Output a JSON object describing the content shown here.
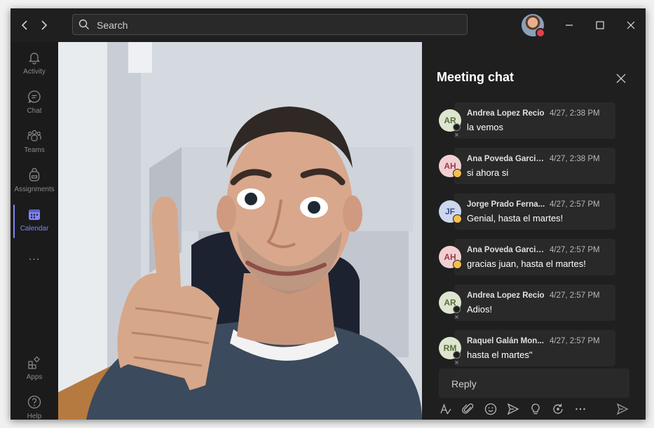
{
  "search": {
    "placeholder": "Search"
  },
  "rail": {
    "items": [
      {
        "id": "activity",
        "label": "Activity"
      },
      {
        "id": "chat",
        "label": "Chat"
      },
      {
        "id": "teams",
        "label": "Teams"
      },
      {
        "id": "assignments",
        "label": "Assignments"
      },
      {
        "id": "calendar",
        "label": "Calendar",
        "active": true
      }
    ],
    "more_label": "...",
    "bottom": [
      {
        "id": "apps",
        "label": "Apps"
      },
      {
        "id": "help",
        "label": "Help"
      }
    ]
  },
  "chat": {
    "title": "Meeting chat",
    "messages": [
      {
        "initials": "AR",
        "name": "Andrea Lopez Recio",
        "time": "4/27, 2:38 PM",
        "text": "la vemos",
        "avatar_bg": "#dde5cf",
        "avatar_fg": "#5a6b3d",
        "status": "offline"
      },
      {
        "initials": "AH",
        "name": "Ana Poveda Garcia...",
        "time": "4/27, 2:38 PM",
        "text": "si ahora si",
        "avatar_bg": "#f2cfd3",
        "avatar_fg": "#9a3b4a",
        "status": "away"
      },
      {
        "initials": "JF",
        "name": "Jorge Prado Ferna...",
        "time": "4/27, 2:57 PM",
        "text": "Genial, hasta el martes!",
        "avatar_bg": "#cdd8ee",
        "avatar_fg": "#3c4f86",
        "status": "away"
      },
      {
        "initials": "AH",
        "name": "Ana Poveda Garcia...",
        "time": "4/27, 2:57 PM",
        "text": "gracias juan, hasta el martes!",
        "avatar_bg": "#f2cfd3",
        "avatar_fg": "#9a3b4a",
        "status": "away"
      },
      {
        "initials": "AR",
        "name": "Andrea Lopez Recio",
        "time": "4/27, 2:57 PM",
        "text": "Adios!",
        "avatar_bg": "#dde5cf",
        "avatar_fg": "#5a6b3d",
        "status": "offline"
      },
      {
        "initials": "RM",
        "name": "Raquel Galán Mon...",
        "time": "4/27, 2:57 PM",
        "text": "hasta el martes\"",
        "avatar_bg": "#dde5cf",
        "avatar_fg": "#5a6b3d",
        "status": "offline"
      }
    ],
    "reply_placeholder": "Reply"
  },
  "colors": {
    "accent": "#7f85f5",
    "away": "#f8c04b",
    "offline": "#8a8a8a",
    "busy": "#e3404b"
  }
}
